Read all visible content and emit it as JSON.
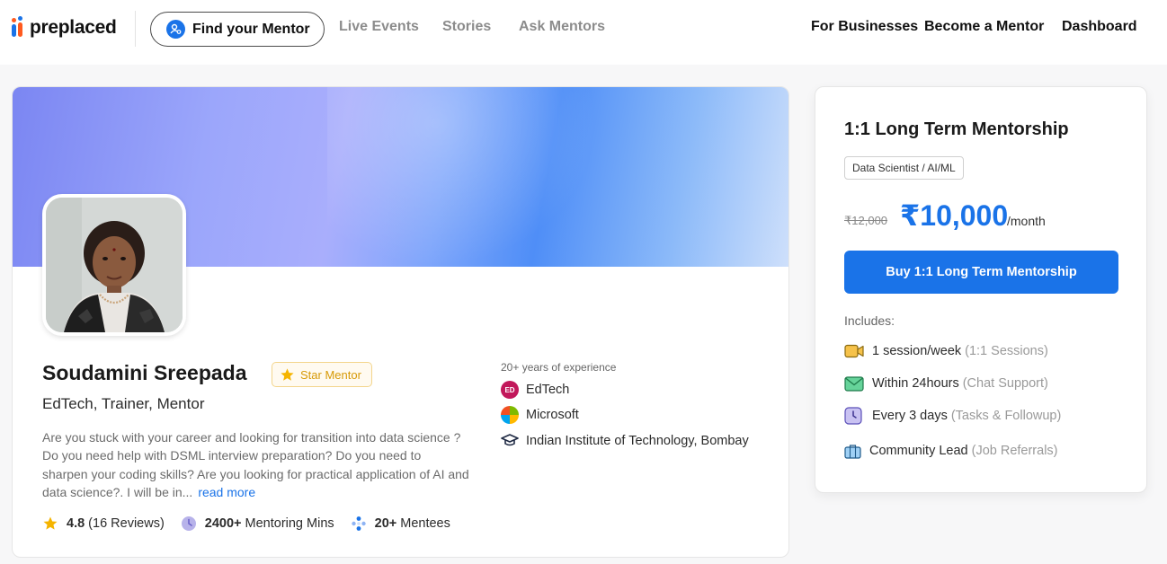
{
  "header": {
    "logo_text": "preplaced",
    "nav_find": "Find your Mentor",
    "nav_links": [
      "Live Events",
      "Stories",
      "Ask Mentors"
    ],
    "nav_right": [
      "For Businesses",
      "Become a Mentor",
      "Dashboard"
    ]
  },
  "profile": {
    "name": "Soudamini Sreepada",
    "badge": "Star Mentor",
    "subtitle": "EdTech, Trainer, Mentor",
    "bio": "Are you stuck with your career and looking for transition into data science ? Do you need help with DSML interview preparation? Do you need to sharpen your coding skills? Are you looking for practical application of AI and data science?. I will be in...",
    "read_more": "read more",
    "stats": {
      "rating": "4.8",
      "reviews": "(16 Reviews)",
      "mins_value": "2400+",
      "mins_label": "Mentoring Mins",
      "mentees_value": "20+",
      "mentees_label": "Mentees"
    },
    "experience_title": "20+ years of experience",
    "experience": [
      {
        "label": "EdTech",
        "icon": "edtech-icon",
        "icon_text": "ED"
      },
      {
        "label": "Microsoft",
        "icon": "microsoft-icon"
      },
      {
        "label": "Indian Institute of Technology, Bombay",
        "icon": "graduation-cap-icon"
      }
    ]
  },
  "pricing": {
    "title": "1:1 Long Term Mentorship",
    "tag": "Data Scientist / AI/ML",
    "old_price": "₹12,000",
    "new_price": "₹10,000",
    "period": "/month",
    "buy_label": "Buy 1:1 Long Term Mentorship",
    "includes_label": "Includes:",
    "includes": [
      {
        "text": "1 session/week",
        "note": "(1:1 Sessions)",
        "icon": "video-icon"
      },
      {
        "text": "Within 24hours",
        "note": "(Chat Support)",
        "icon": "mail-icon"
      },
      {
        "text": "Every 3 days",
        "note": "(Tasks & Followup)",
        "icon": "clock-icon"
      },
      {
        "text": "Community Lead",
        "note": "(Job Referrals)",
        "icon": "briefcase-icon"
      }
    ]
  },
  "colors": {
    "accent": "#1a73e8",
    "star": "#f5b400",
    "badge_text": "#d79a08"
  }
}
